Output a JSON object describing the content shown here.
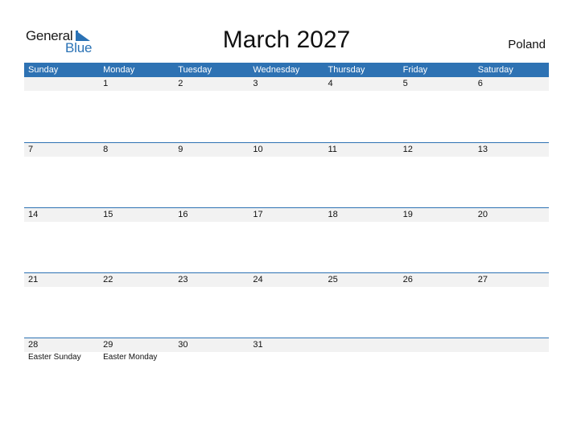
{
  "logo": {
    "line1": "General",
    "line2": "Blue",
    "accent": "#2a72b5"
  },
  "title": "March 2027",
  "country": "Poland",
  "colors": {
    "header_bg": "#2e72b3",
    "date_band_bg": "#f2f2f2"
  },
  "weekdays": [
    "Sunday",
    "Monday",
    "Tuesday",
    "Wednesday",
    "Thursday",
    "Friday",
    "Saturday"
  ],
  "weeks": [
    {
      "dates": [
        "",
        "1",
        "2",
        "3",
        "4",
        "5",
        "6"
      ],
      "holidays": [
        "",
        "",
        "",
        "",
        "",
        "",
        ""
      ]
    },
    {
      "dates": [
        "7",
        "8",
        "9",
        "10",
        "11",
        "12",
        "13"
      ],
      "holidays": [
        "",
        "",
        "",
        "",
        "",
        "",
        ""
      ]
    },
    {
      "dates": [
        "14",
        "15",
        "16",
        "17",
        "18",
        "19",
        "20"
      ],
      "holidays": [
        "",
        "",
        "",
        "",
        "",
        "",
        ""
      ]
    },
    {
      "dates": [
        "21",
        "22",
        "23",
        "24",
        "25",
        "26",
        "27"
      ],
      "holidays": [
        "",
        "",
        "",
        "",
        "",
        "",
        ""
      ]
    },
    {
      "dates": [
        "28",
        "29",
        "30",
        "31",
        "",
        "",
        ""
      ],
      "holidays": [
        "Easter Sunday",
        "Easter Monday",
        "",
        "",
        "",
        "",
        ""
      ]
    }
  ]
}
